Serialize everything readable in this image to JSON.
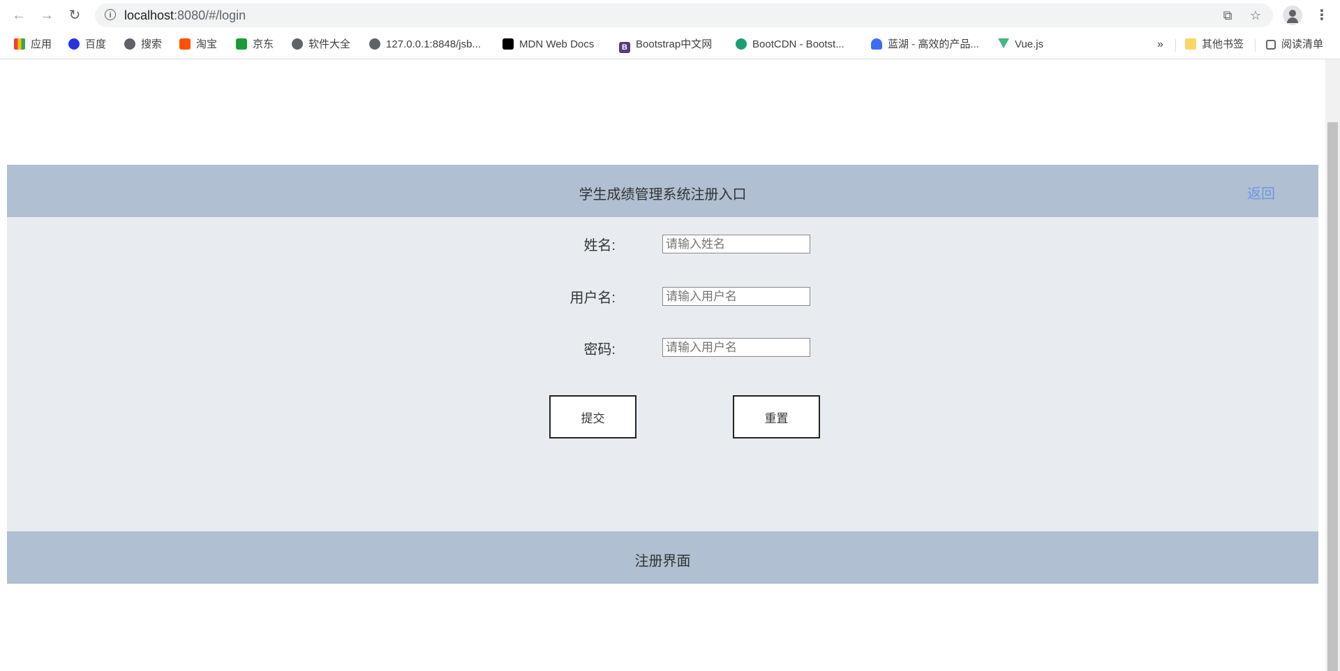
{
  "browser": {
    "url_host": "localhost",
    "url_rest": ":8080/#/login",
    "info_glyph": "i",
    "bookmarks": [
      {
        "label": "应用",
        "icon": "apps-grid-icon"
      },
      {
        "label": "百度",
        "icon": "baidu-paw-icon",
        "color": "#2932e1"
      },
      {
        "label": "搜索",
        "icon": "globe-icon"
      },
      {
        "label": "淘宝",
        "icon": "taobao-icon",
        "color": "#ff5000"
      },
      {
        "label": "京东",
        "icon": "jd-icon",
        "color": "#1a9b3b"
      },
      {
        "label": "软件大全",
        "icon": "globe-icon"
      },
      {
        "label": "127.0.0.1:8848/jsb...",
        "icon": "globe-icon"
      },
      {
        "label": "MDN Web Docs",
        "icon": "mdn-icon",
        "color": "#000000"
      },
      {
        "label": "Bootstrap中文网",
        "icon": "bootstrap-icon",
        "color": "#563d7c",
        "glyph": "B"
      },
      {
        "label": "BootCDN - Bootst...",
        "icon": "bootcdn-icon",
        "color": "#1a9f75"
      },
      {
        "label": "蓝湖 - 高效的产品...",
        "icon": "lanhu-icon",
        "color": "#3d6df2"
      },
      {
        "label": "Vue.js",
        "icon": "vue-icon",
        "color": "#41b883"
      }
    ],
    "overflow_label": "»",
    "other_bookmarks": "其他书签",
    "reading_list": "阅读清单"
  },
  "header": {
    "title": "学生成绩管理系统注册入口",
    "back_label": "返回"
  },
  "form": {
    "name_label": "姓名:",
    "name_placeholder": "请输入姓名",
    "username_label": "用户名:",
    "username_placeholder": "请输入用户名",
    "password_label": "密码:",
    "password_placeholder": "请输入用户名",
    "submit_label": "提交",
    "reset_label": "重置"
  },
  "footer": {
    "text": "注册界面"
  },
  "colors": {
    "bar": "#b0bfd1",
    "form_bg": "#e8ecf0",
    "link": "#6f96e6"
  }
}
